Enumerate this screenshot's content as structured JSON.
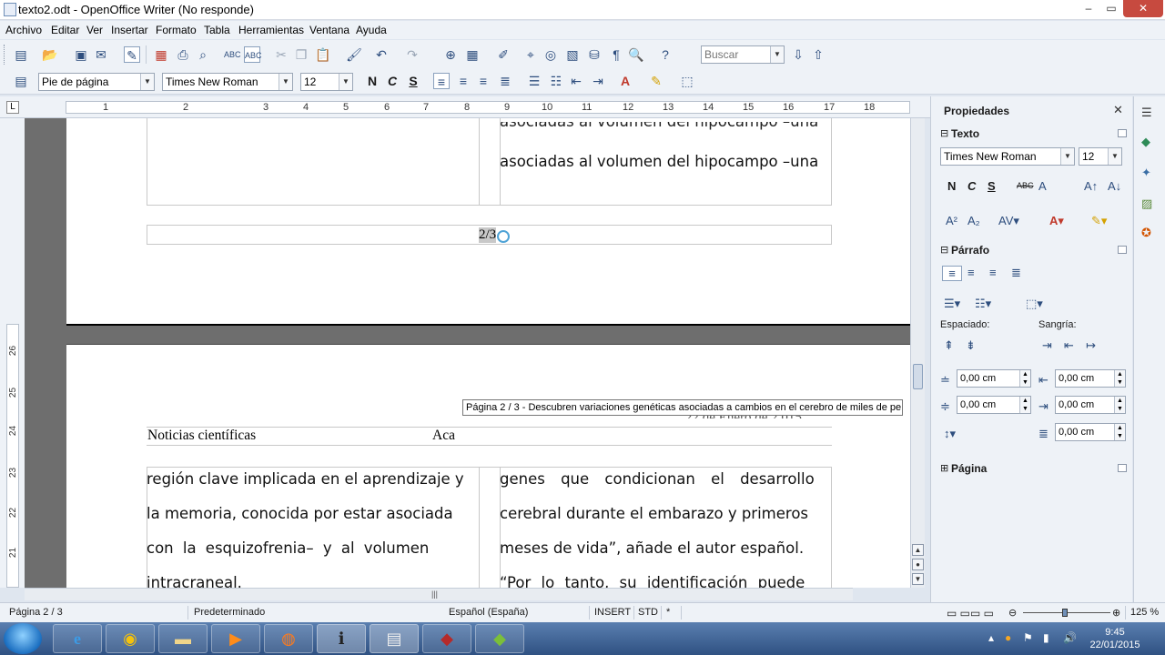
{
  "window": {
    "title": "texto2.odt - OpenOffice Writer (No responde)",
    "min": "–",
    "max": "▭",
    "close": "✕"
  },
  "menu": [
    "Archivo",
    "Editar",
    "Ver",
    "Insertar",
    "Formato",
    "Tabla",
    "Herramientas",
    "Ventana",
    "Ayuda"
  ],
  "toolbar1": {
    "search_placeholder": "Buscar"
  },
  "toolbar2": {
    "paragraph_style": "Pie de página",
    "font_name": "Times New Roman",
    "font_size": "12",
    "bold": "N",
    "italic": "C",
    "underline": "S"
  },
  "ruler": {
    "numbers": [
      "1",
      "1",
      "2",
      "3",
      "4",
      "5",
      "6",
      "7",
      "8",
      "9",
      "10",
      "11",
      "12",
      "13",
      "14",
      "15",
      "16",
      "17",
      "18"
    ]
  },
  "vruler": {
    "numbers": [
      "26",
      "25",
      "24",
      "23",
      "22",
      "21"
    ]
  },
  "document": {
    "page1_col2_line_cut": "asociadas al volumen del hipocampo –una",
    "page1_col2_line": "asociadas al volumen del hipocampo –una",
    "page_number_field": "2/3",
    "header_left": "Noticias científicas",
    "header_mid": "Aca",
    "header_right_ghost": "22 de Enero de 2.015",
    "col1": [
      "región clave implicada en el aprendizaje y",
      "la memoria, conocida por estar asociada",
      "con  la  esquizofrenia–  y  al  volumen",
      "intracraneal."
    ],
    "col2": [
      "genes  que  condicionan  el  desarrollo",
      "cerebral durante el embarazo y primeros",
      "meses de vida”, añade el autor español.",
      "“Por  lo  tanto,  su  identificación  puede"
    ]
  },
  "tooltip": "Página  2 / 3  - Descubren variaciones genéticas asociadas a cambios en el cerebro de miles de pe",
  "sidebar": {
    "title": "Propiedades",
    "close": "✕",
    "text_section": "Texto",
    "font_name": "Times New Roman",
    "font_size": "12",
    "bold": "N",
    "italic": "C",
    "underline": "S",
    "strike": "ABC",
    "paragraph_section": "Párrafo",
    "spacing_label": "Espaciado:",
    "indent_label": "Sangría:",
    "spacing_above": "0,00 cm",
    "spacing_below": "0,00 cm",
    "indent_before": "0,00 cm",
    "indent_after": "0,00 cm",
    "indent_first": "0,00 cm",
    "line_spacing": "0,00 cm",
    "page_section": "Página"
  },
  "status": {
    "page": "Página  2 / 3",
    "style": "Predeterminado",
    "language": "Español (España)",
    "insert": "INSERT",
    "selection": "STD",
    "modified": "*",
    "zoom": "125 %"
  },
  "taskbar": {
    "time": "9:45",
    "date": "22/01/2015"
  },
  "colors": {
    "accent": "#2e4e7e",
    "close_red": "#c74a3f",
    "taskbar": "#2f5182"
  }
}
